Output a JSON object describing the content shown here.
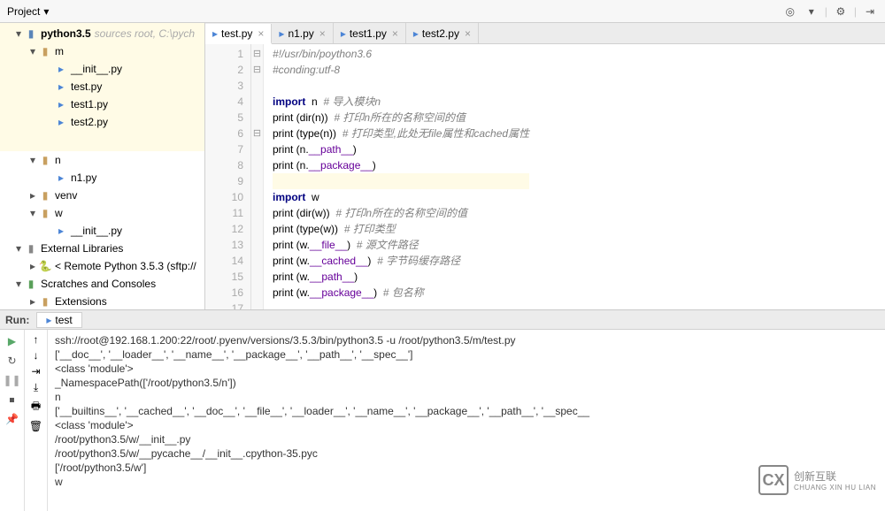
{
  "toolbar": {
    "project_label": "Project"
  },
  "project_tree": {
    "root": {
      "name": "python3.5",
      "hint": "sources root,  C:\\pych"
    },
    "m": {
      "name": "m",
      "files": [
        "__init__.py",
        "test.py",
        "test1.py",
        "test2.py"
      ]
    },
    "n": {
      "name": "n",
      "files": [
        "n1.py"
      ]
    },
    "venv": "venv",
    "w": {
      "name": "w",
      "files": [
        "__init__.py"
      ]
    },
    "ext_lib": "External Libraries",
    "remote": "< Remote Python 3.5.3 (sftp://",
    "scratches": "Scratches and Consoles",
    "extensions": "Extensions"
  },
  "tabs": [
    {
      "label": "test.py",
      "active": true
    },
    {
      "label": "n1.py",
      "active": false
    },
    {
      "label": "test1.py",
      "active": false
    },
    {
      "label": "test2.py",
      "active": false
    }
  ],
  "line_numbers": [
    "1",
    "2",
    "3",
    "4",
    "5",
    "6",
    "7",
    "8",
    "9",
    "10",
    "11",
    "12",
    "13",
    "14",
    "15",
    "16",
    "17"
  ],
  "code": {
    "l1": {
      "cm": "#!/usr/bin/poython3.6"
    },
    "l2": {
      "cm": "#conding:utf-8"
    },
    "l4_a": "import",
    "l4_b": "  n  ",
    "l4_c": "# 导入模块n",
    "l5_a": "print (dir(n))  ",
    "l5_c": "# 打印n所在的名称空间的值",
    "l6_a": "print (type(n))  ",
    "l6_c": "# 打印类型,此处无file属性和cached属性",
    "l7_a": "print (n.",
    "l7_m": "__path__",
    "l7_b": ")",
    "l8_a": "print (n.",
    "l8_m": "__package__",
    "l8_b": ")",
    "l10_a": "import",
    "l10_b": "  w",
    "l11_a": "print (dir(w))  ",
    "l11_c": "# 打印n所在的名称空间的值",
    "l12_a": "print (type(w))  ",
    "l12_c": "# 打印类型",
    "l13_a": "print (w.",
    "l13_m": "__file__",
    "l13_b": ")  ",
    "l13_c": "# 源文件路径",
    "l14_a": "print (w.",
    "l14_m": "__cached__",
    "l14_b": ")  ",
    "l14_c": "# 字节码缓存路径",
    "l15_a": "print (w.",
    "l15_m": "__path__",
    "l15_b": ")",
    "l16_a": "print (w.",
    "l16_m": "__package__",
    "l16_b": ")  ",
    "l16_c": "# 包名称"
  },
  "run": {
    "title": "Run:",
    "config": "test",
    "out": [
      "ssh://root@192.168.1.200:22/root/.pyenv/versions/3.5.3/bin/python3.5 -u /root/python3.5/m/test.py",
      "['__doc__', '__loader__', '__name__', '__package__', '__path__', '__spec__']",
      "<class 'module'>",
      "_NamespacePath(['/root/python3.5/n'])",
      "n",
      "['__builtins__', '__cached__', '__doc__', '__file__', '__loader__', '__name__', '__package__', '__path__', '__spec__",
      "<class 'module'>",
      "/root/python3.5/w/__init__.py",
      "/root/python3.5/w/__pycache__/__init__.cpython-35.pyc",
      "['/root/python3.5/w']",
      "w"
    ]
  },
  "watermark": {
    "logo": "CX",
    "text": "创新互联",
    "sub": "CHUANG XIN HU LIAN"
  }
}
